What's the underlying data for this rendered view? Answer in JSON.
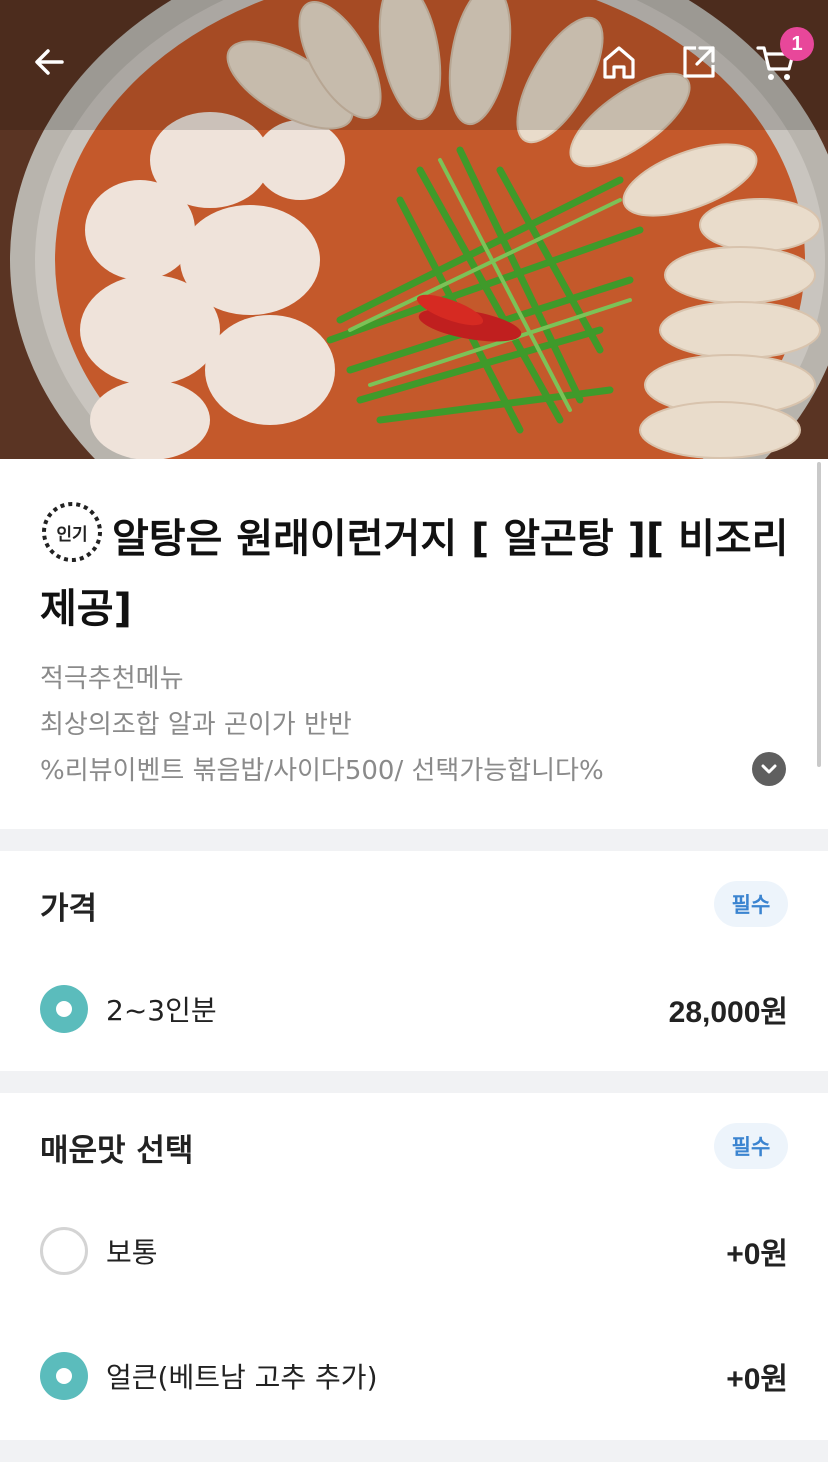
{
  "topbar": {
    "back_icon": "arrow-left-icon",
    "home_icon": "home-icon",
    "share_icon": "share-icon",
    "cart_icon": "cart-icon",
    "cart_count": "1"
  },
  "product": {
    "popular_badge": "인기",
    "title": "알탕은 원래이런거지 [ 알곤탕 ][ 비조리제공]",
    "description": [
      "적극추천메뉴",
      "최상의조합 알과 곤이가 반반",
      "%리뷰이벤트 볶음밥/사이다500/ 선택가능합니다%"
    ]
  },
  "price_section": {
    "title": "가격",
    "required_label": "필수",
    "options": [
      {
        "label": "2~3인분",
        "price": "28,000원",
        "selected": true
      }
    ]
  },
  "spicy_section": {
    "title": "매운맛 선택",
    "required_label": "필수",
    "options": [
      {
        "label": "보통",
        "price": "+0원",
        "selected": false
      },
      {
        "label": "얼큰(베트남 고추 추가)",
        "price": "+0원",
        "selected": true
      }
    ]
  },
  "colors": {
    "accent_teal": "#5bbcbc",
    "badge_pink": "#e8479a",
    "required_blue": "#3b84d0"
  }
}
